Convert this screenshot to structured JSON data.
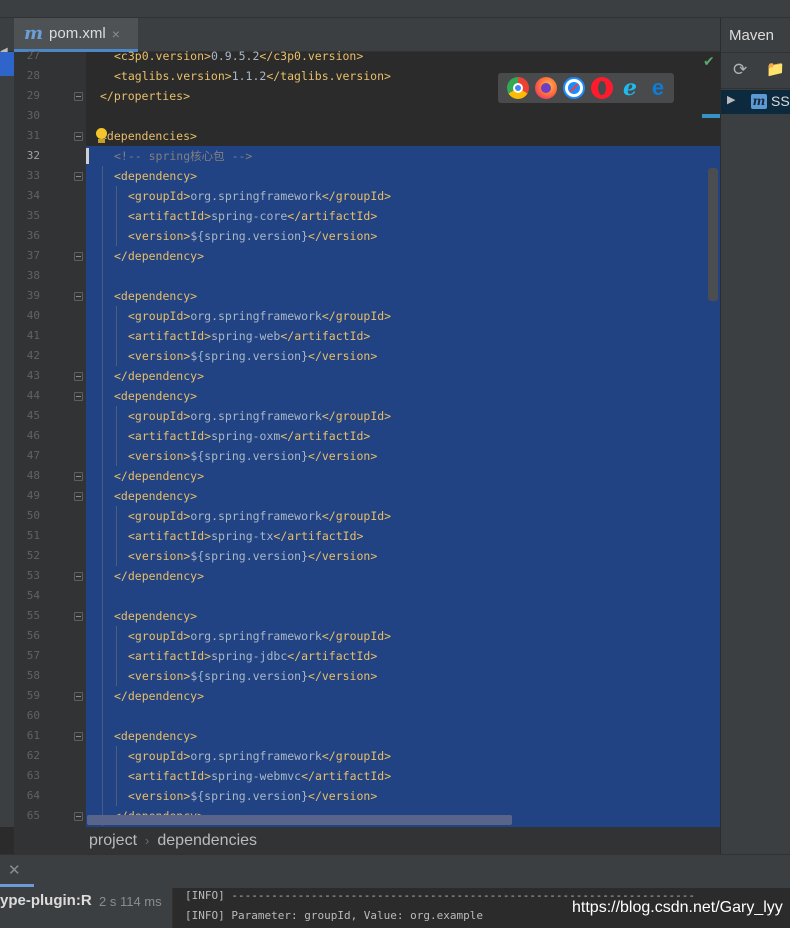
{
  "editor": {
    "tab": {
      "icon": "m",
      "label": "pom.xml",
      "close": "×"
    },
    "current_line": 32,
    "lines": [
      {
        "num": "27",
        "indent": 2,
        "segs": [
          [
            "tg",
            "<c3p0.version>"
          ],
          [
            "tx",
            "0.9.5.2"
          ],
          [
            "tg",
            "</c3p0.version>"
          ]
        ]
      },
      {
        "num": "28",
        "indent": 2,
        "segs": [
          [
            "tg",
            "<taglibs.version>"
          ],
          [
            "tx",
            "1.1.2"
          ],
          [
            "tg",
            "</taglibs.version>"
          ]
        ]
      },
      {
        "num": "29",
        "indent": 1,
        "fold": true,
        "segs": [
          [
            "tg",
            "</properties>"
          ]
        ]
      },
      {
        "num": "30",
        "indent": 0,
        "segs": []
      },
      {
        "num": "31",
        "indent": 1,
        "fold": true,
        "segs": [
          [
            "tg",
            "<dependencies>"
          ]
        ]
      },
      {
        "num": "32",
        "indent": 2,
        "segs": [
          [
            "cm",
            "<!-- spring核心包 -->"
          ]
        ]
      },
      {
        "num": "33",
        "indent": 2,
        "fold": true,
        "segs": [
          [
            "tg",
            "<dependency>"
          ]
        ]
      },
      {
        "num": "34",
        "indent": 3,
        "segs": [
          [
            "tg",
            "<groupId>"
          ],
          [
            "tx",
            "org.springframework"
          ],
          [
            "tg",
            "</groupId>"
          ]
        ]
      },
      {
        "num": "35",
        "indent": 3,
        "segs": [
          [
            "tg",
            "<artifactId>"
          ],
          [
            "tx",
            "spring-core"
          ],
          [
            "tg",
            "</artifactId>"
          ]
        ]
      },
      {
        "num": "36",
        "indent": 3,
        "segs": [
          [
            "tg",
            "<version>"
          ],
          [
            "tx",
            "${spring.version}"
          ],
          [
            "tg",
            "</version>"
          ]
        ]
      },
      {
        "num": "37",
        "indent": 2,
        "fold": true,
        "segs": [
          [
            "tg",
            "</dependency>"
          ]
        ]
      },
      {
        "num": "38",
        "indent": 0,
        "segs": []
      },
      {
        "num": "39",
        "indent": 2,
        "fold": true,
        "segs": [
          [
            "tg",
            "<dependency>"
          ]
        ]
      },
      {
        "num": "40",
        "indent": 3,
        "segs": [
          [
            "tg",
            "<groupId>"
          ],
          [
            "tx",
            "org.springframework"
          ],
          [
            "tg",
            "</groupId>"
          ]
        ]
      },
      {
        "num": "41",
        "indent": 3,
        "segs": [
          [
            "tg",
            "<artifactId>"
          ],
          [
            "tx",
            "spring-web"
          ],
          [
            "tg",
            "</artifactId>"
          ]
        ]
      },
      {
        "num": "42",
        "indent": 3,
        "segs": [
          [
            "tg",
            "<version>"
          ],
          [
            "tx",
            "${spring.version}"
          ],
          [
            "tg",
            "</version>"
          ]
        ]
      },
      {
        "num": "43",
        "indent": 2,
        "fold": true,
        "segs": [
          [
            "tg",
            "</dependency>"
          ]
        ]
      },
      {
        "num": "44",
        "indent": 2,
        "fold": true,
        "segs": [
          [
            "tg",
            "<dependency>"
          ]
        ]
      },
      {
        "num": "45",
        "indent": 3,
        "segs": [
          [
            "tg",
            "<groupId>"
          ],
          [
            "tx",
            "org.springframework"
          ],
          [
            "tg",
            "</groupId>"
          ]
        ]
      },
      {
        "num": "46",
        "indent": 3,
        "segs": [
          [
            "tg",
            "<artifactId>"
          ],
          [
            "tx",
            "spring-oxm"
          ],
          [
            "tg",
            "</artifactId>"
          ]
        ]
      },
      {
        "num": "47",
        "indent": 3,
        "segs": [
          [
            "tg",
            "<version>"
          ],
          [
            "tx",
            "${spring.version}"
          ],
          [
            "tg",
            "</version>"
          ]
        ]
      },
      {
        "num": "48",
        "indent": 2,
        "fold": true,
        "segs": [
          [
            "tg",
            "</dependency>"
          ]
        ]
      },
      {
        "num": "49",
        "indent": 2,
        "fold": true,
        "segs": [
          [
            "tg",
            "<dependency>"
          ]
        ]
      },
      {
        "num": "50",
        "indent": 3,
        "segs": [
          [
            "tg",
            "<groupId>"
          ],
          [
            "tx",
            "org.springframework"
          ],
          [
            "tg",
            "</groupId>"
          ]
        ]
      },
      {
        "num": "51",
        "indent": 3,
        "segs": [
          [
            "tg",
            "<artifactId>"
          ],
          [
            "tx",
            "spring-tx"
          ],
          [
            "tg",
            "</artifactId>"
          ]
        ]
      },
      {
        "num": "52",
        "indent": 3,
        "segs": [
          [
            "tg",
            "<version>"
          ],
          [
            "tx",
            "${spring.version}"
          ],
          [
            "tg",
            "</version>"
          ]
        ]
      },
      {
        "num": "53",
        "indent": 2,
        "fold": true,
        "segs": [
          [
            "tg",
            "</dependency>"
          ]
        ]
      },
      {
        "num": "54",
        "indent": 0,
        "segs": []
      },
      {
        "num": "55",
        "indent": 2,
        "fold": true,
        "segs": [
          [
            "tg",
            "<dependency>"
          ]
        ]
      },
      {
        "num": "56",
        "indent": 3,
        "segs": [
          [
            "tg",
            "<groupId>"
          ],
          [
            "tx",
            "org.springframework"
          ],
          [
            "tg",
            "</groupId>"
          ]
        ]
      },
      {
        "num": "57",
        "indent": 3,
        "segs": [
          [
            "tg",
            "<artifactId>"
          ],
          [
            "tx",
            "spring-jdbc"
          ],
          [
            "tg",
            "</artifactId>"
          ]
        ]
      },
      {
        "num": "58",
        "indent": 3,
        "segs": [
          [
            "tg",
            "<version>"
          ],
          [
            "tx",
            "${spring.version}"
          ],
          [
            "tg",
            "</version>"
          ]
        ]
      },
      {
        "num": "59",
        "indent": 2,
        "fold": true,
        "segs": [
          [
            "tg",
            "</dependency>"
          ]
        ]
      },
      {
        "num": "60",
        "indent": 0,
        "segs": []
      },
      {
        "num": "61",
        "indent": 2,
        "fold": true,
        "segs": [
          [
            "tg",
            "<dependency>"
          ]
        ]
      },
      {
        "num": "62",
        "indent": 3,
        "segs": [
          [
            "tg",
            "<groupId>"
          ],
          [
            "tx",
            "org.springframework"
          ],
          [
            "tg",
            "</groupId>"
          ]
        ]
      },
      {
        "num": "63",
        "indent": 3,
        "segs": [
          [
            "tg",
            "<artifactId>"
          ],
          [
            "tx",
            "spring-webmvc"
          ],
          [
            "tg",
            "</artifactId>"
          ]
        ]
      },
      {
        "num": "64",
        "indent": 3,
        "segs": [
          [
            "tg",
            "<version>"
          ],
          [
            "tx",
            "${spring.version}"
          ],
          [
            "tg",
            "</version>"
          ]
        ]
      },
      {
        "num": "65",
        "indent": 2,
        "fold": true,
        "segs": [
          [
            "tg",
            "</dependency>"
          ]
        ]
      }
    ]
  },
  "browsers": [
    "chrome-icon",
    "firefox-icon",
    "safari-icon",
    "opera-icon",
    "internet-explorer-icon",
    "edge-icon"
  ],
  "maven": {
    "title": "Maven",
    "project": "SS"
  },
  "breadcrumb": {
    "items": [
      "project",
      "dependencies"
    ]
  },
  "run": {
    "name": "ype-plugin:R",
    "time": "2 s 114 ms",
    "console": [
      "[INFO] ----------------------------------------------------------------------",
      "[INFO] Parameter: groupId, Value: org.example"
    ]
  },
  "watermark": "https://blog.csdn.net/Gary_lyy",
  "colors": {
    "tag": "#e8bf6a",
    "text": "#a9b7c6",
    "comment": "#808080",
    "selection": "#214283"
  }
}
